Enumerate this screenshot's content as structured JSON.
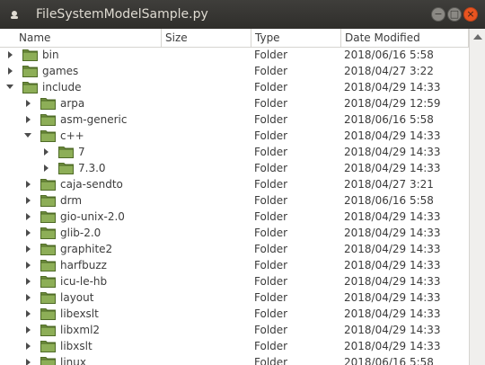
{
  "window": {
    "title": "FileSystemModelSample.py"
  },
  "columns": [
    "Name",
    "Size",
    "Type",
    "Date Modified"
  ],
  "rows": [
    {
      "name": "bin",
      "type": "Folder",
      "date": "2018/06/16 5:58",
      "depth": 0,
      "expanded": false
    },
    {
      "name": "games",
      "type": "Folder",
      "date": "2018/04/27 3:22",
      "depth": 0,
      "expanded": false
    },
    {
      "name": "include",
      "type": "Folder",
      "date": "2018/04/29 14:33",
      "depth": 0,
      "expanded": true
    },
    {
      "name": "arpa",
      "type": "Folder",
      "date": "2018/04/29 12:59",
      "depth": 1,
      "expanded": false
    },
    {
      "name": "asm-generic",
      "type": "Folder",
      "date": "2018/06/16 5:58",
      "depth": 1,
      "expanded": false
    },
    {
      "name": "c++",
      "type": "Folder",
      "date": "2018/04/29 14:33",
      "depth": 1,
      "expanded": true
    },
    {
      "name": "7",
      "type": "Folder",
      "date": "2018/04/29 14:33",
      "depth": 2,
      "expanded": false
    },
    {
      "name": "7.3.0",
      "type": "Folder",
      "date": "2018/04/29 14:33",
      "depth": 2,
      "expanded": false
    },
    {
      "name": "caja-sendto",
      "type": "Folder",
      "date": "2018/04/27 3:21",
      "depth": 1,
      "expanded": false
    },
    {
      "name": "drm",
      "type": "Folder",
      "date": "2018/06/16 5:58",
      "depth": 1,
      "expanded": false
    },
    {
      "name": "gio-unix-2.0",
      "type": "Folder",
      "date": "2018/04/29 14:33",
      "depth": 1,
      "expanded": false
    },
    {
      "name": "glib-2.0",
      "type": "Folder",
      "date": "2018/04/29 14:33",
      "depth": 1,
      "expanded": false
    },
    {
      "name": "graphite2",
      "type": "Folder",
      "date": "2018/04/29 14:33",
      "depth": 1,
      "expanded": false
    },
    {
      "name": "harfbuzz",
      "type": "Folder",
      "date": "2018/04/29 14:33",
      "depth": 1,
      "expanded": false
    },
    {
      "name": "icu-le-hb",
      "type": "Folder",
      "date": "2018/04/29 14:33",
      "depth": 1,
      "expanded": false
    },
    {
      "name": "layout",
      "type": "Folder",
      "date": "2018/04/29 14:33",
      "depth": 1,
      "expanded": false
    },
    {
      "name": "libexslt",
      "type": "Folder",
      "date": "2018/04/29 14:33",
      "depth": 1,
      "expanded": false
    },
    {
      "name": "libxml2",
      "type": "Folder",
      "date": "2018/04/29 14:33",
      "depth": 1,
      "expanded": false
    },
    {
      "name": "libxslt",
      "type": "Folder",
      "date": "2018/04/29 14:33",
      "depth": 1,
      "expanded": false
    },
    {
      "name": "linux",
      "type": "Folder",
      "date": "2018/06/16 5:58",
      "depth": 1,
      "expanded": false
    }
  ],
  "icons": {
    "folder": "folder-icon",
    "expand": "expand-arrow-icon",
    "collapse": "collapse-arrow-icon"
  },
  "colors": {
    "titlebar": "#3c3b37",
    "close_button": "#e95420",
    "folder": "#8dae57"
  }
}
